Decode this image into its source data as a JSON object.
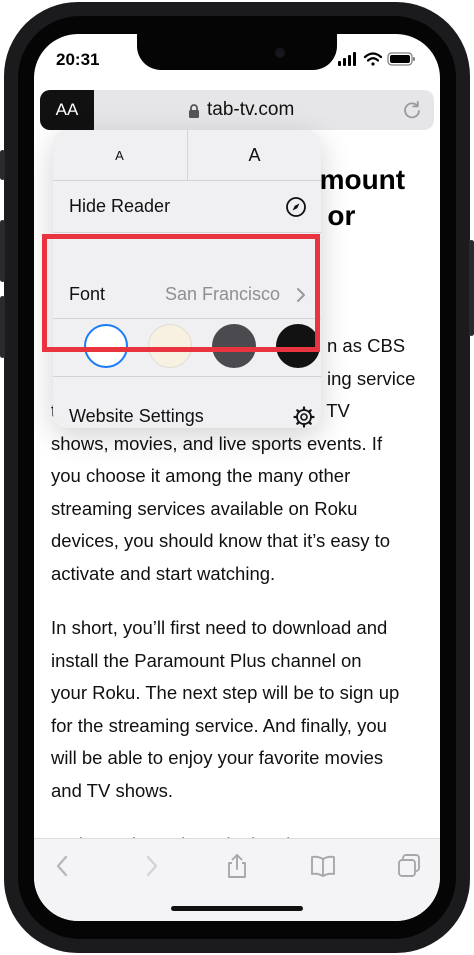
{
  "status_bar": {
    "time": "20:31"
  },
  "address_bar": {
    "reader_button_label": "AA",
    "url": "tab-tv.com"
  },
  "article": {
    "headline_lines": [
      "amount",
      "e or"
    ],
    "paragraph1_lines": [
      "n as CBS",
      "ing service",
      "that provides access to exclusive TV",
      "shows, movies, and live sports events. If",
      "you choose it among the many other",
      "streaming services available on Roku",
      "devices, you should know that it’s easy to",
      "activate and start watching."
    ],
    "paragraph2_lines": [
      "In short, you’ll first need to download and",
      "install the Paramount Plus channel on",
      "your Roku. The next step will be to sign up",
      "for the streaming service. And finally, you",
      "will be able to enjoy your favorite movies",
      "and TV shows."
    ],
    "paragraph3_partial": "So let’s take a closer look at how to start"
  },
  "reader_menu": {
    "font_smaller_label": "A",
    "font_larger_label": "A",
    "hide_reader_label": "Hide Reader",
    "font_label": "Font",
    "font_value": "San Francisco",
    "website_settings_label": "Website Settings",
    "themes": [
      {
        "name": "white",
        "color": "#ffffff",
        "selected": true
      },
      {
        "name": "sepia",
        "color": "#f8f1e2",
        "selected": false
      },
      {
        "name": "gray",
        "color": "#4a4a4f",
        "selected": false
      },
      {
        "name": "black",
        "color": "#121212",
        "selected": false
      }
    ]
  },
  "colors": {
    "highlight": "#e8343f",
    "accent": "#1a7cf5"
  },
  "toolbar": {
    "icons": [
      "back-icon",
      "forward-icon",
      "share-icon",
      "bookmarks-icon",
      "tabs-icon"
    ]
  }
}
